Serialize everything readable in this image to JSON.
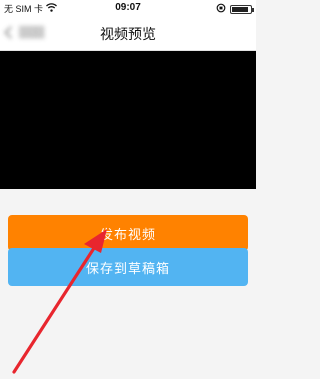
{
  "status_bar": {
    "carrier": "无 SIM 卡",
    "time": "09:07",
    "battery_level": 0.9
  },
  "nav": {
    "title": "视频预览"
  },
  "actions": {
    "publish_label": "发布视频",
    "save_draft_label": "保存到草稿箱"
  },
  "colors": {
    "publish": "#ff8200",
    "save_draft": "#52b4f2",
    "annotation_arrow": "#e8262e"
  },
  "icons": {
    "wifi": "wifi-icon",
    "orientation_lock": "orientation-lock-icon",
    "battery": "battery-icon",
    "back": "back-chevron-icon"
  }
}
